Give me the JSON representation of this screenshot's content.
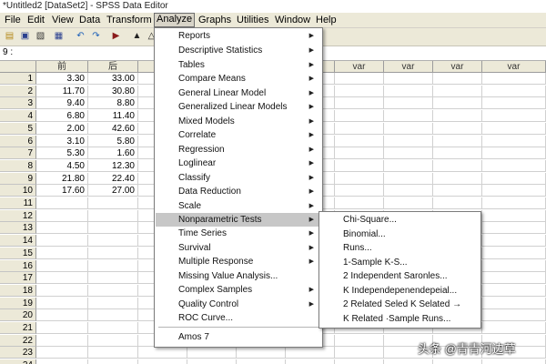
{
  "window": {
    "title": "*Untitled2 [DataSet2] - SPSS Data Editor"
  },
  "menubar": [
    "File",
    "Edit",
    "View",
    "Data",
    "Transform",
    "Analyze",
    "Graphs",
    "Utilities",
    "Window",
    "Help"
  ],
  "menubar_active": "Analyze",
  "cell_reference": "9 :",
  "columns": [
    "前",
    "后",
    "var",
    "var",
    "var",
    "var",
    "var",
    "var",
    "var",
    "var"
  ],
  "rows": [
    [
      "3.30",
      "33.00"
    ],
    [
      "11.70",
      "30.80"
    ],
    [
      "9.40",
      "8.80"
    ],
    [
      "6.80",
      "11.40"
    ],
    [
      "2.00",
      "42.60"
    ],
    [
      "3.10",
      "5.80"
    ],
    [
      "5.30",
      "1.60"
    ],
    [
      "4.50",
      "12.30"
    ],
    [
      "21.80",
      "22.40"
    ],
    [
      "17.60",
      "27.00"
    ]
  ],
  "row_numbers": [
    "1",
    "2",
    "3",
    "4",
    "5",
    "6",
    "7",
    "8",
    "9",
    "10",
    "11",
    "12",
    "13",
    "14",
    "15",
    "16",
    "17",
    "18",
    "19",
    "20",
    "21",
    "22",
    "23",
    "24"
  ],
  "analyze_menu": {
    "items": [
      {
        "label": "Reports",
        "submenu": true
      },
      {
        "label": "Descriptive Statistics",
        "submenu": true
      },
      {
        "label": "Tables",
        "submenu": true
      },
      {
        "label": "Compare Means",
        "submenu": true
      },
      {
        "label": "General Linear Model",
        "submenu": true
      },
      {
        "label": "Generalized Linear Models",
        "submenu": true
      },
      {
        "label": "Mixed Models",
        "submenu": true
      },
      {
        "label": "Correlate",
        "submenu": true
      },
      {
        "label": "Regression",
        "submenu": true
      },
      {
        "label": "Loglinear",
        "submenu": true
      },
      {
        "label": "Classify",
        "submenu": true
      },
      {
        "label": "Data Reduction",
        "submenu": true
      },
      {
        "label": "Scale",
        "submenu": true
      },
      {
        "label": "Nonparametric Tests",
        "submenu": true,
        "highlighted": true
      },
      {
        "label": "Time Series",
        "submenu": true
      },
      {
        "label": "Survival",
        "submenu": true
      },
      {
        "label": "Multiple Response",
        "submenu": true
      },
      {
        "label": "Missing Value Analysis...",
        "submenu": false
      },
      {
        "label": "Complex Samples",
        "submenu": true
      },
      {
        "label": "Quality Control",
        "submenu": true
      },
      {
        "label": "ROC Curve...",
        "submenu": false
      },
      {
        "label": "Amos 7",
        "submenu": false
      }
    ]
  },
  "nonparametric_submenu": [
    "Chi-Square...",
    "Binomial...",
    "Runs...",
    "1-Sample K-S...",
    "2 Independent Saronles...",
    "K Independepenendepeial...",
    "2 Related Seled K Selated →",
    "K Related ·Sample Runs..."
  ],
  "toolbar_icons": [
    "open-folder-icon",
    "save-icon",
    "print-icon",
    "dialog-recall-icon",
    "undo-icon",
    "redo-icon",
    "goto-case-icon",
    "variables-icon"
  ],
  "watermark": "头条 @青青河边草",
  "colors": {
    "menu_highlight": "#c7c7c7",
    "chrome": "#ece9d8"
  }
}
